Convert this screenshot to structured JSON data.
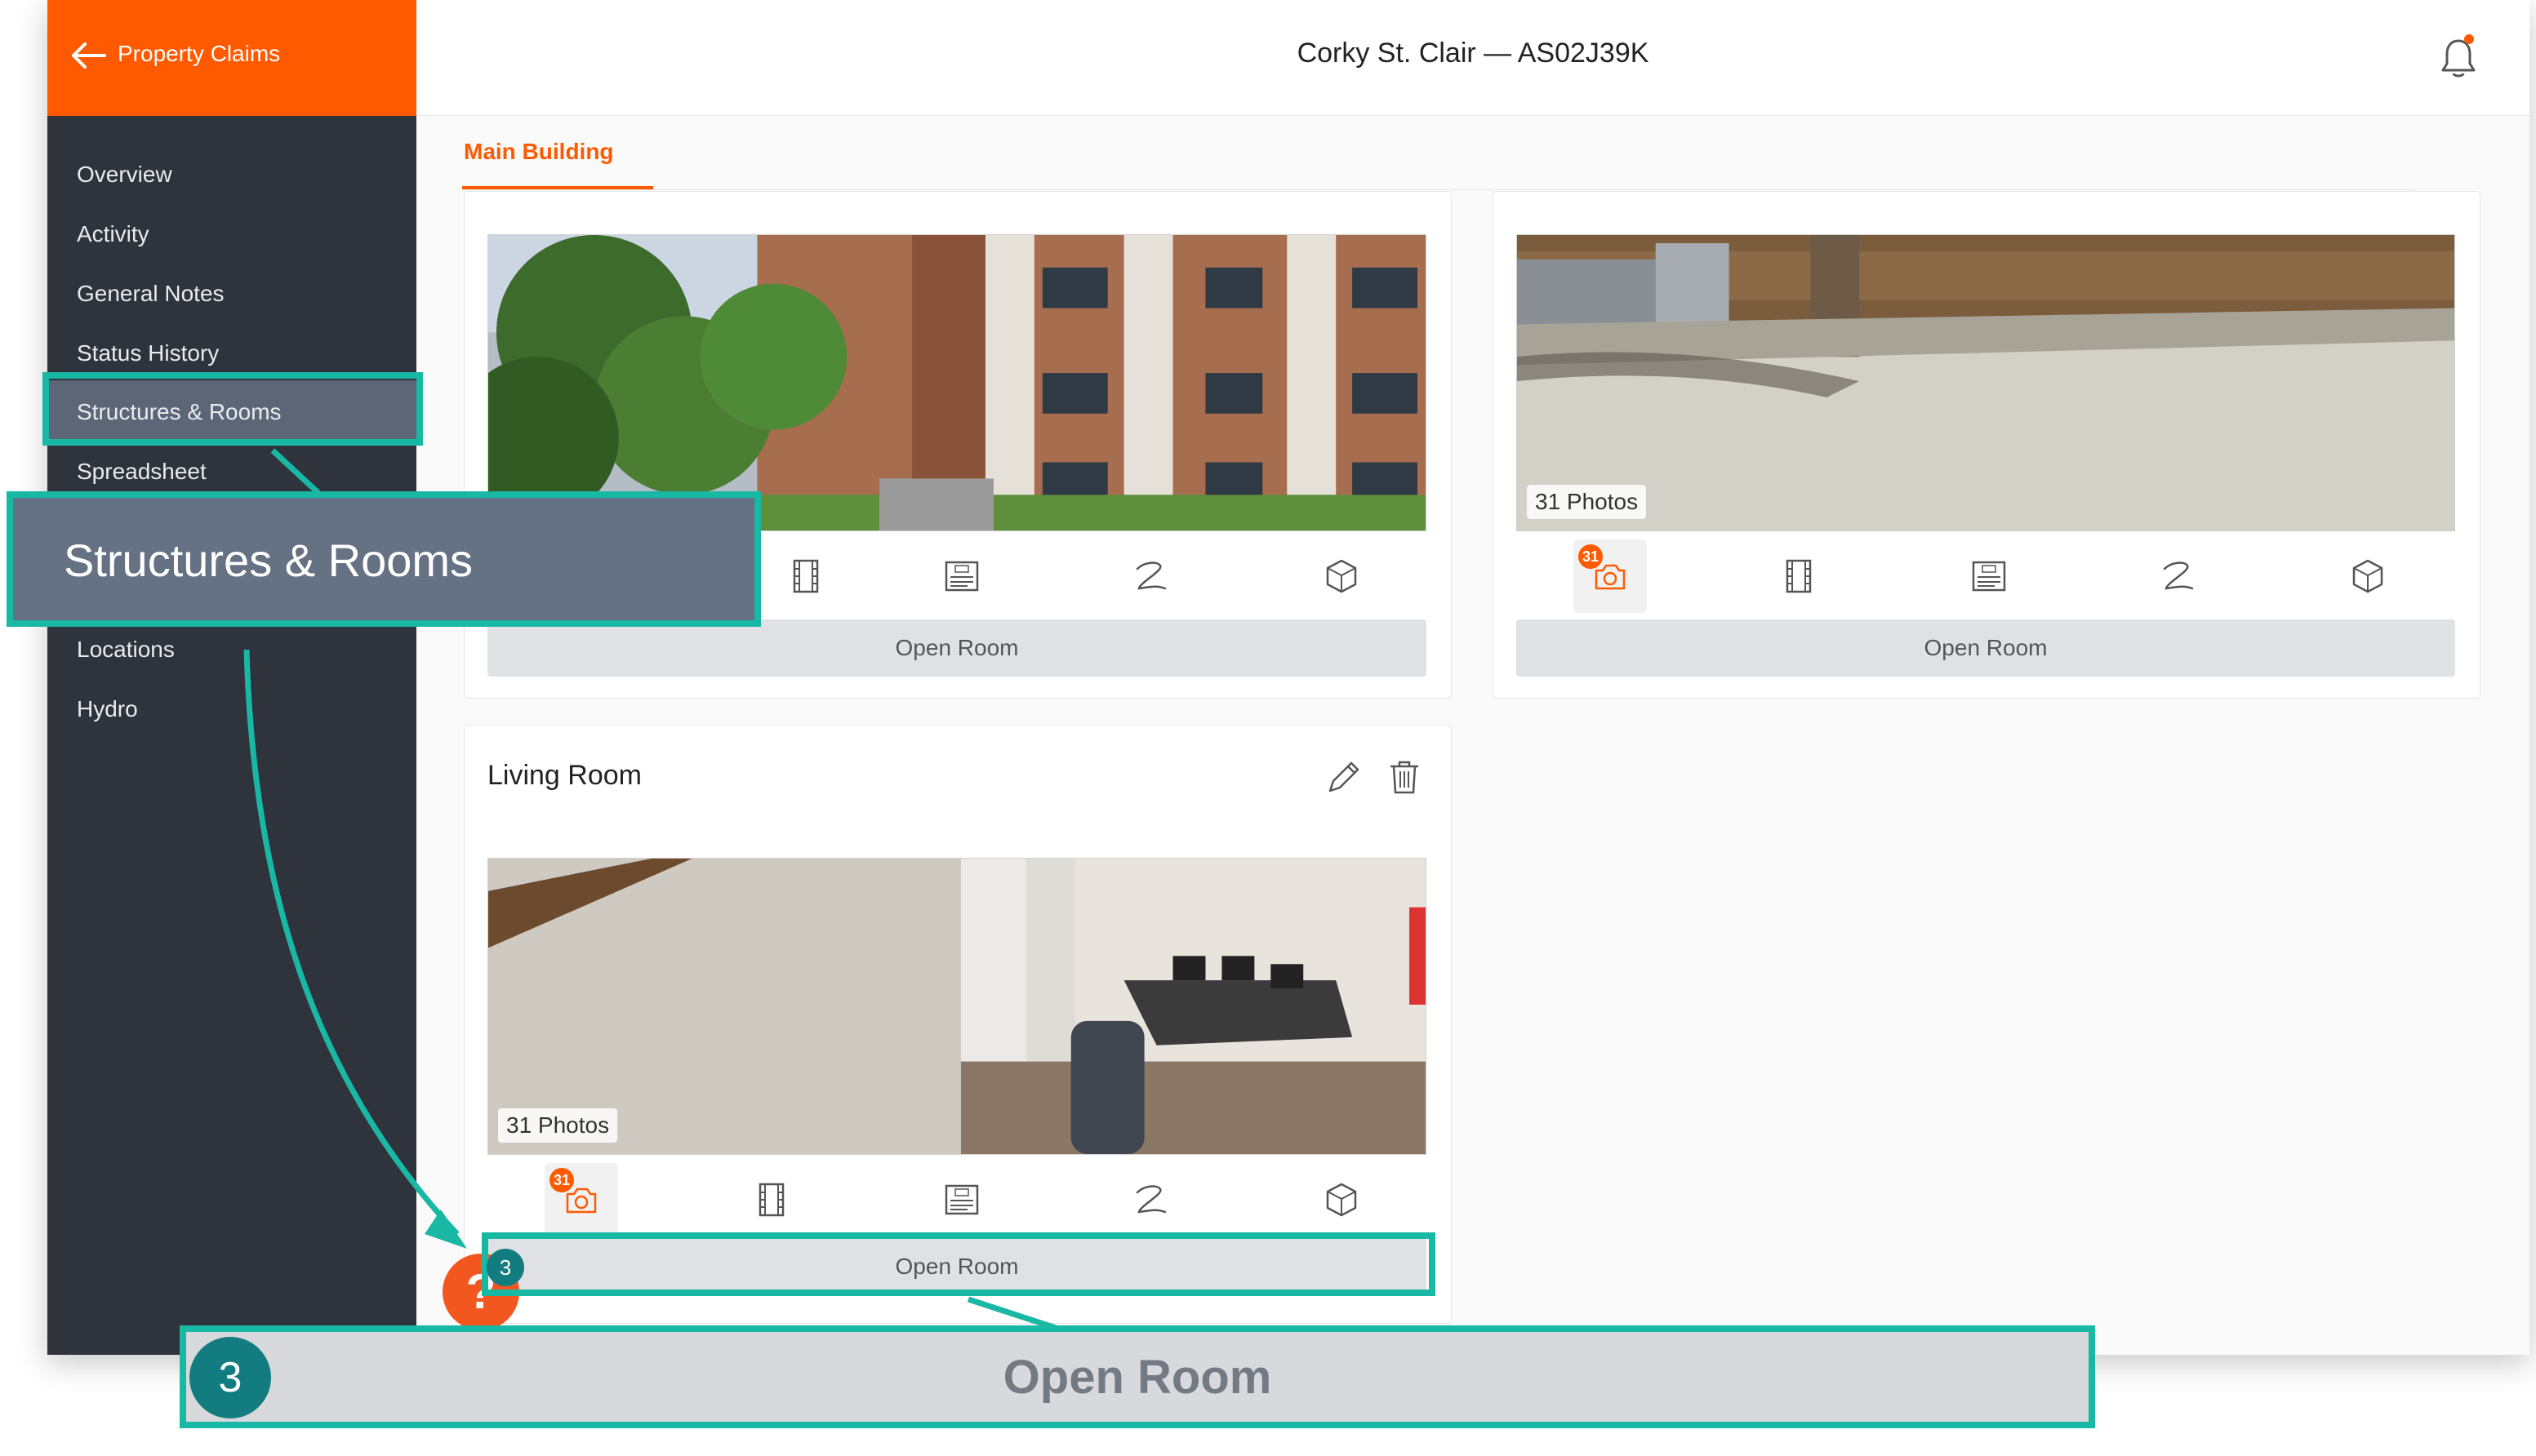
{
  "app": {
    "brand_label": "Property Claims",
    "header_title": "Corky St. Clair — AS02J39K"
  },
  "sidebar": {
    "items": [
      {
        "label": "Overview"
      },
      {
        "label": "Activity"
      },
      {
        "label": "General Notes"
      },
      {
        "label": "Status History"
      },
      {
        "label": "Structures & Rooms",
        "selected": true
      },
      {
        "label": "Spreadsheet"
      },
      {
        "label": "Locations"
      },
      {
        "label": "Hydro"
      }
    ]
  },
  "tabs": [
    {
      "label": "Main Building",
      "active": true
    }
  ],
  "rooms": [
    {
      "name": "",
      "photo_count_label": "",
      "open_label": "Open Room"
    },
    {
      "name": "",
      "photo_count_label": "31 Photos",
      "badge": "31",
      "open_label": "Open Room"
    },
    {
      "name": "Living Room",
      "photo_count_label": "31 Photos",
      "badge": "31",
      "open_label": "Open Room"
    }
  ],
  "room_icons": [
    "camera-icon",
    "film-icon",
    "document-icon",
    "signature-icon",
    "cube-icon"
  ],
  "tutorial": {
    "sidebar_callout": "Structures & Rooms",
    "step_number": "3",
    "button_callout": "Open Room",
    "help_symbol": "?"
  },
  "colors": {
    "accent": "#ff5a00",
    "sidebar": "#2e333c",
    "highlight": "#19b8a5",
    "step": "#137c80"
  }
}
